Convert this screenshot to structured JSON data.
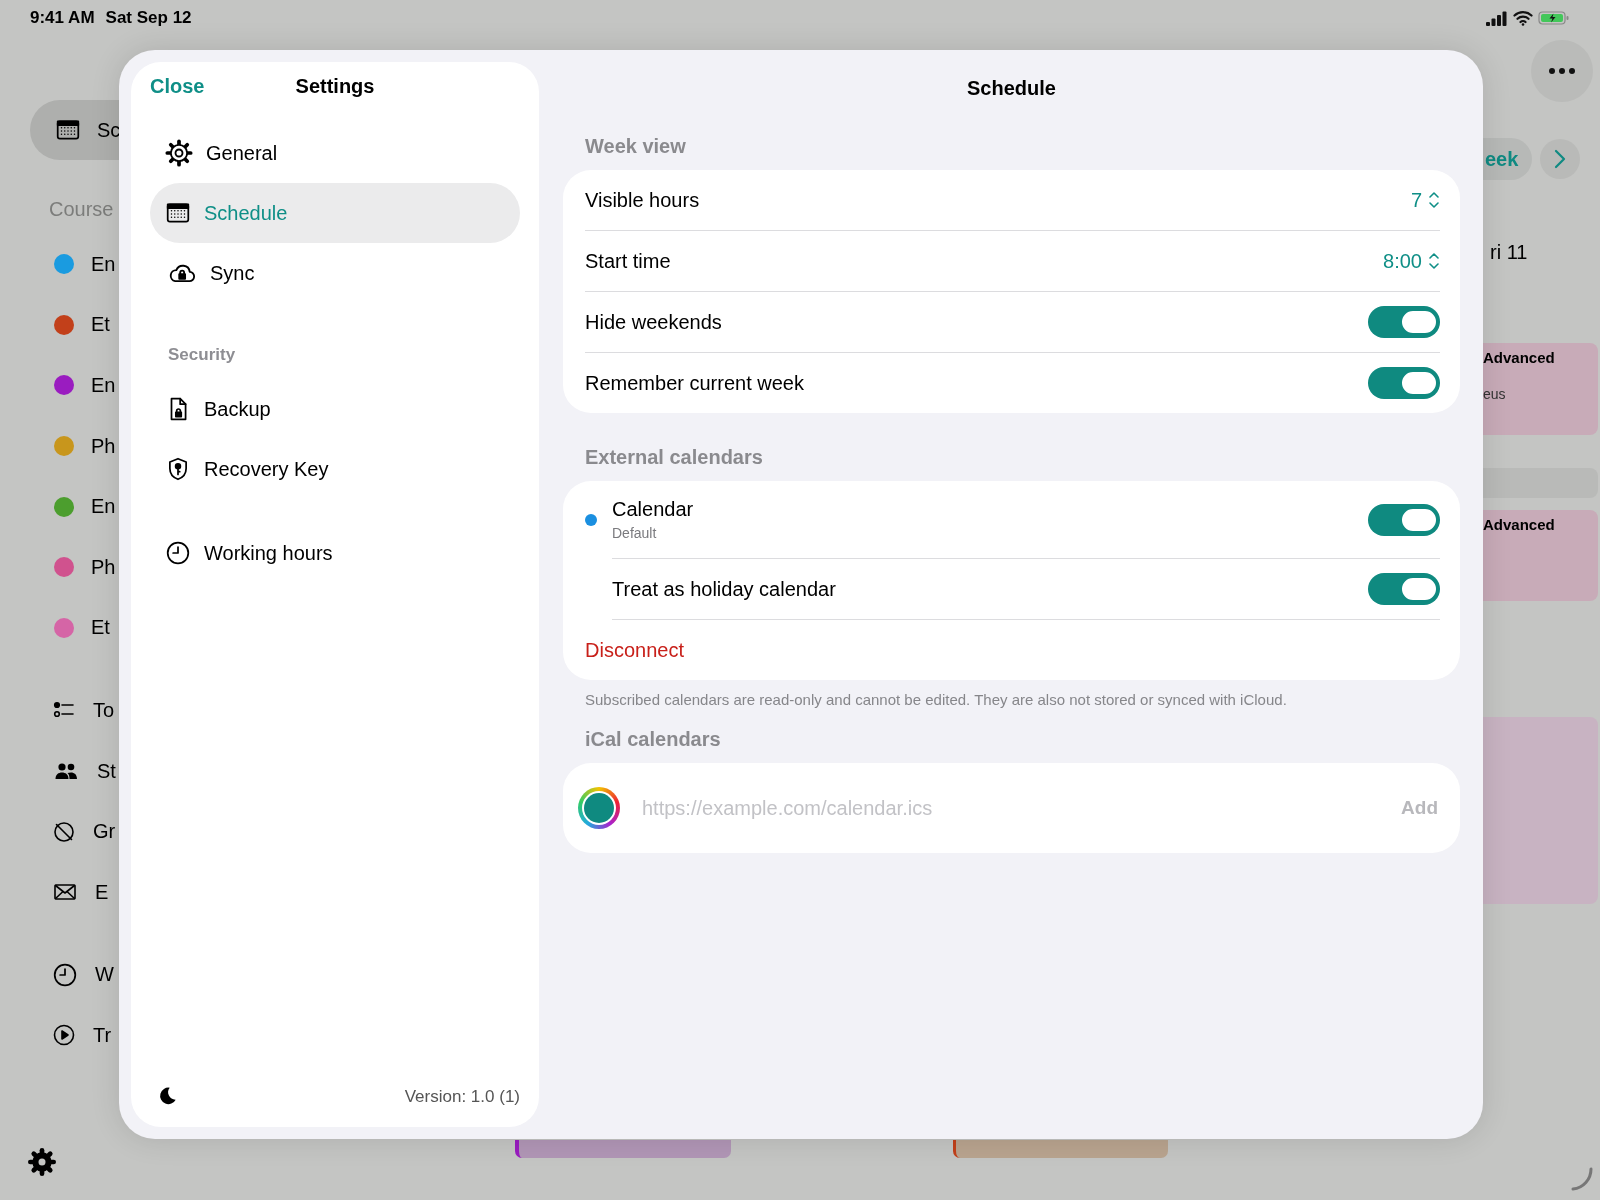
{
  "status_bar": {
    "time": "9:41 AM",
    "date": "Sat Sep 12"
  },
  "background_sidebar": {
    "nav": [
      {
        "label": "Sc",
        "selected": true
      }
    ],
    "section_header": "Course",
    "courses": [
      {
        "label": "En",
        "color": "#1a9be0"
      },
      {
        "label": "Et",
        "color": "#c2401a"
      },
      {
        "label": "En",
        "color": "#9a1cc0"
      },
      {
        "label": "Ph",
        "color": "#c8961c"
      },
      {
        "label": "En",
        "color": "#4c9e2e"
      },
      {
        "label": "Ph",
        "color": "#d0528e"
      },
      {
        "label": "Et",
        "color": "#d565a6"
      }
    ],
    "tool_groups": [
      {
        "items": [
          {
            "label": "To"
          },
          {
            "label": "St"
          },
          {
            "label": "Gr"
          },
          {
            "label": "E"
          }
        ]
      },
      {
        "items": [
          {
            "label": "W"
          },
          {
            "label": "Tr"
          }
        ]
      }
    ]
  },
  "background_calendar": {
    "week_button": "eek",
    "day_header": "ri 11",
    "events": [
      {
        "title": "Advanced",
        "subtitle": "eus"
      },
      {
        "title": "Advanced"
      }
    ]
  },
  "settings": {
    "close": "Close",
    "title": "Settings",
    "nav_groups": [
      {
        "items": [
          {
            "label": "General",
            "selected": false
          },
          {
            "label": "Schedule",
            "selected": true
          },
          {
            "label": "Sync",
            "selected": false
          }
        ]
      },
      {
        "header": "Security",
        "items": [
          {
            "label": "Backup",
            "selected": false
          },
          {
            "label": "Recovery Key",
            "selected": false
          }
        ]
      },
      {
        "items": [
          {
            "label": "Working hours",
            "selected": false
          }
        ]
      }
    ],
    "version": "Version: 1.0 (1)"
  },
  "schedule": {
    "title": "Schedule",
    "sections": [
      {
        "header": "Week view",
        "rows": [
          {
            "kind": "picker",
            "label": "Visible hours",
            "value": "7"
          },
          {
            "kind": "picker",
            "label": "Start time",
            "value": "8:00"
          },
          {
            "kind": "toggle",
            "label": "Hide weekends",
            "on": true
          },
          {
            "kind": "toggle",
            "label": "Remember current week",
            "on": true
          }
        ]
      },
      {
        "header": "External calendars",
        "footer": "Subscribed calendars are read-only and cannot be edited. They are also not stored or synced with iCloud.",
        "rows": [
          {
            "kind": "calendar",
            "label": "Calendar",
            "subtitle": "Default",
            "color": "#1a8fe0",
            "on": true
          },
          {
            "kind": "subtoggle",
            "label": "Treat as holiday calendar",
            "on": true
          },
          {
            "kind": "destructive",
            "label": "Disconnect"
          }
        ]
      },
      {
        "header": "iCal calendars",
        "rows": [
          {
            "kind": "url",
            "placeholder": "https://example.com/calendar.ics",
            "action": "Add"
          }
        ]
      }
    ]
  }
}
